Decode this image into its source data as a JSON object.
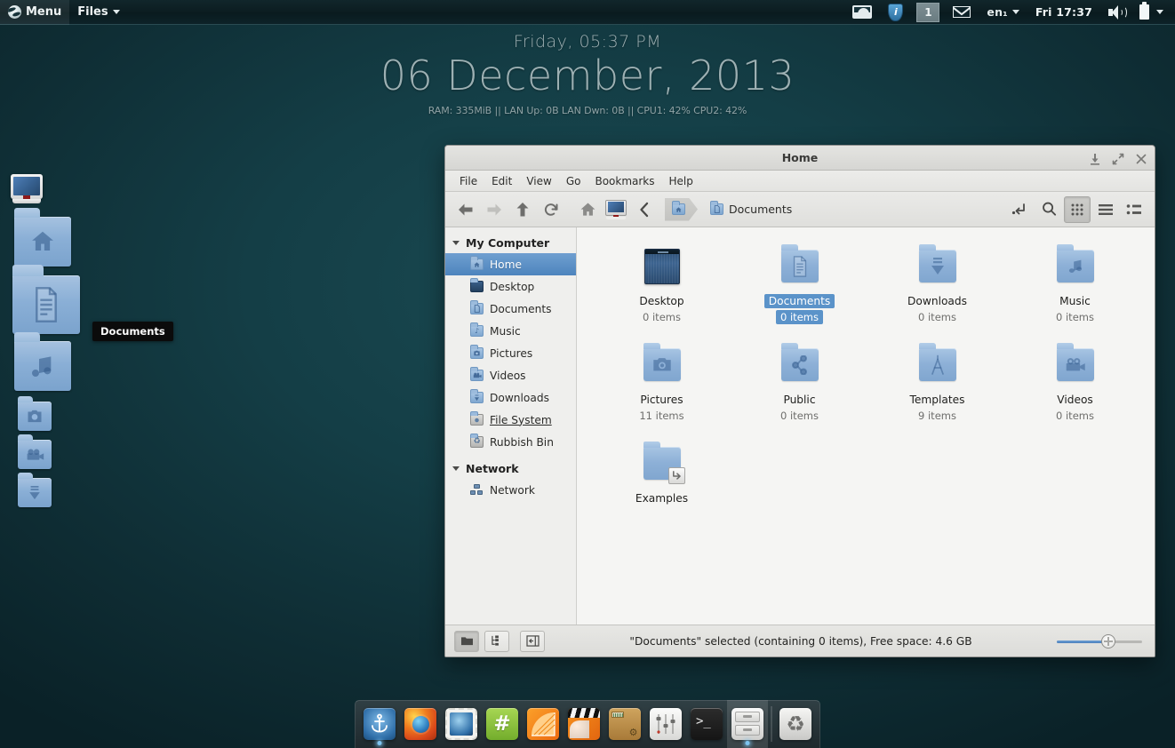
{
  "panel": {
    "menu_label": "Menu",
    "menu_icon": "globe-icon",
    "files_label": "Files",
    "tray": {
      "wallpaper_icon": "wallpaper-icon",
      "updates_icon": "shield-info-icon",
      "workspace": "1",
      "mail_icon": "mail-envelope-icon",
      "keyboard_layout": "en₁",
      "clock": "Fri 17:37",
      "volume_icon": "speaker-icon",
      "battery_icon": "battery-icon",
      "more_icon": "chevron-down-icon"
    }
  },
  "conky": {
    "time": "Friday, 05:37 PM",
    "date": "06 December, 2013",
    "stats": "RAM: 335MiB || LAN Up: 0B  LAN Dwn: 0B  || CPU1: 42% CPU2: 42%"
  },
  "desktop": {
    "tooltip": "Documents",
    "dock_items": [
      {
        "name": "computer",
        "icon": "computer-monitor-icon",
        "size": 36
      },
      {
        "name": "Home",
        "icon": "home-folder-icon",
        "size": 64
      },
      {
        "name": "Documents",
        "icon": "documents-folder-icon",
        "size": 76
      },
      {
        "name": "Music",
        "icon": "music-folder-icon",
        "size": 64
      },
      {
        "name": "Pictures",
        "icon": "pictures-folder-icon",
        "size": 38
      },
      {
        "name": "Videos",
        "icon": "videos-folder-icon",
        "size": 38
      },
      {
        "name": "Downloads",
        "icon": "downloads-folder-icon",
        "size": 38
      }
    ]
  },
  "window": {
    "title": "Home",
    "controls": {
      "minimize": "minimize-icon",
      "maximize": "maximize-icon",
      "close": "close-icon"
    },
    "menubar": [
      "File",
      "Edit",
      "View",
      "Go",
      "Bookmarks",
      "Help"
    ],
    "toolbar": {
      "back": "back-arrow-icon",
      "forward": "forward-arrow-icon",
      "up": "up-arrow-icon",
      "reload": "reload-icon",
      "home": "home-icon",
      "computer": "computer-icon",
      "previous_pane": "chevron-left-icon",
      "path_entry": "path-entry-icon",
      "search": "search-icon",
      "view_icons": "icon-view-icon",
      "view_list": "list-view-icon",
      "view_compact": "compact-view-icon",
      "active_view": "icons"
    },
    "breadcrumb": [
      {
        "label": "",
        "icon": "home-folder-icon",
        "active": true
      },
      {
        "label": "Documents",
        "icon": "documents-folder-icon",
        "active": false
      }
    ],
    "sidebar": {
      "groups": [
        {
          "title": "My Computer",
          "items": [
            {
              "label": "Home",
              "icon": "home-folder-icon",
              "state": "selected"
            },
            {
              "label": "Desktop",
              "icon": "desktop-folder-icon",
              "state": "normal"
            },
            {
              "label": "Documents",
              "icon": "documents-folder-icon",
              "state": "normal"
            },
            {
              "label": "Music",
              "icon": "music-folder-icon",
              "state": "normal"
            },
            {
              "label": "Pictures",
              "icon": "pictures-folder-icon",
              "state": "normal"
            },
            {
              "label": "Videos",
              "icon": "videos-folder-icon",
              "state": "normal"
            },
            {
              "label": "Downloads",
              "icon": "downloads-folder-icon",
              "state": "normal"
            },
            {
              "label": "File System",
              "icon": "drive-icon",
              "state": "hovered"
            },
            {
              "label": "Rubbish Bin",
              "icon": "trash-icon",
              "state": "normal"
            }
          ]
        },
        {
          "title": "Network",
          "items": [
            {
              "label": "Network",
              "icon": "network-icon",
              "state": "normal"
            }
          ]
        }
      ]
    },
    "files": [
      {
        "label": "Desktop",
        "sub": "0 items",
        "icon": "desktop-thumbnail",
        "selected": false
      },
      {
        "label": "Documents",
        "sub": "0 items",
        "icon": "documents-folder",
        "selected": true
      },
      {
        "label": "Downloads",
        "sub": "0 items",
        "icon": "downloads-folder",
        "selected": false
      },
      {
        "label": "Music",
        "sub": "0 items",
        "icon": "music-folder",
        "selected": false
      },
      {
        "label": "Pictures",
        "sub": "11 items",
        "icon": "pictures-folder",
        "selected": false
      },
      {
        "label": "Public",
        "sub": "0 items",
        "icon": "public-folder",
        "selected": false
      },
      {
        "label": "Templates",
        "sub": "9 items",
        "icon": "templates-folder",
        "selected": false
      },
      {
        "label": "Videos",
        "sub": "0 items",
        "icon": "videos-folder",
        "selected": false
      },
      {
        "label": "Examples",
        "sub": "",
        "icon": "symlink-folder",
        "selected": false
      }
    ],
    "statusbar": {
      "btn_shortcuts": "shortcuts-view-icon",
      "btn_tree": "tree-view-icon",
      "btn_sidepane": "side-pane-toggle-icon",
      "status": "\"Documents\" selected (containing 0 items), Free space: 4.6 GB",
      "zoom_level": "58%"
    }
  },
  "dock": {
    "items": [
      {
        "name": "anchor",
        "icon": "anchor-icon",
        "running": true,
        "active": false
      },
      {
        "name": "firefox",
        "icon": "firefox-icon",
        "running": false,
        "active": false
      },
      {
        "name": "mail",
        "icon": "mail-stamp-icon",
        "running": false,
        "active": false
      },
      {
        "name": "chat",
        "icon": "hash-chat-icon",
        "running": false,
        "active": false
      },
      {
        "name": "music-player",
        "icon": "citrus-icon",
        "running": false,
        "active": false
      },
      {
        "name": "video-player",
        "icon": "clapperboard-icon",
        "running": false,
        "active": false
      },
      {
        "name": "package-manager",
        "icon": "package-box-icon",
        "running": false,
        "active": false
      },
      {
        "name": "mixer",
        "icon": "sliders-icon",
        "running": false,
        "active": false
      },
      {
        "name": "terminal",
        "icon": "terminal-icon",
        "running": false,
        "active": false
      },
      {
        "name": "file-manager",
        "icon": "file-cabinet-icon",
        "running": true,
        "active": true
      },
      {
        "name": "rubbish-bin",
        "icon": "recycle-icon",
        "running": false,
        "active": false
      }
    ]
  },
  "colors": {
    "wallpaper": "#143e46",
    "panel": "#0c1d21",
    "accent_selection": "#5b93c9",
    "window_chrome": "#e4e4e1",
    "content_bg": "#f5f5f3"
  }
}
